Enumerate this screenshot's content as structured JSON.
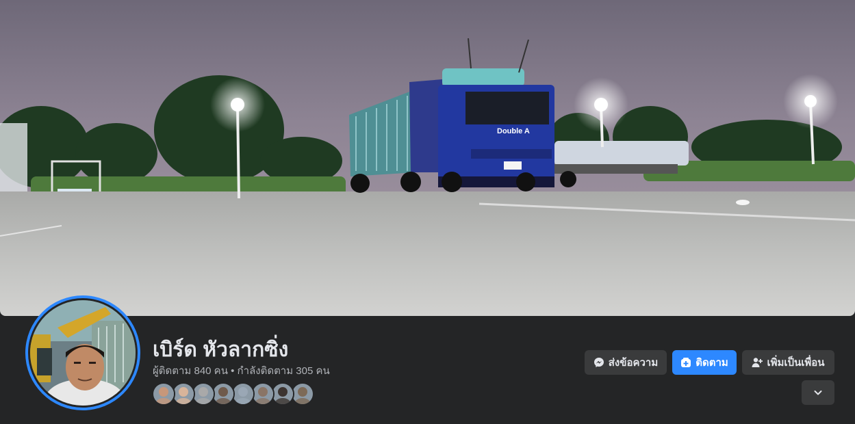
{
  "profile": {
    "name": "เบิร์ด หัวลากซิ่ง",
    "stats": "ผู้ติดตาม 840 คน • กำลังติดตาม 305 คน"
  },
  "cover": {
    "truck_brand": "Double A"
  },
  "actions": {
    "message_label": "ส่งข้อความ",
    "follow_label": "ติดตาม",
    "add_friend_label": "เพิ่มเป็นเพื่อน"
  },
  "friends": [
    {
      "icon": "friend-avatar",
      "color": "#c7977a"
    },
    {
      "icon": "friend-avatar",
      "color": "#d8b49a"
    },
    {
      "icon": "friend-avatar",
      "color": "#a9a9a9"
    },
    {
      "icon": "friend-avatar",
      "color": "#6f5a4b"
    },
    {
      "icon": "friend-avatar",
      "color": "#9aa7b5"
    },
    {
      "icon": "friend-avatar",
      "color": "#8a7566"
    },
    {
      "icon": "friend-avatar",
      "color": "#3c3430"
    },
    {
      "icon": "friend-avatar",
      "color": "#7d6a57"
    }
  ],
  "colors": {
    "accent": "#2d88ff",
    "background": "#242526",
    "button": "#3a3b3c"
  }
}
